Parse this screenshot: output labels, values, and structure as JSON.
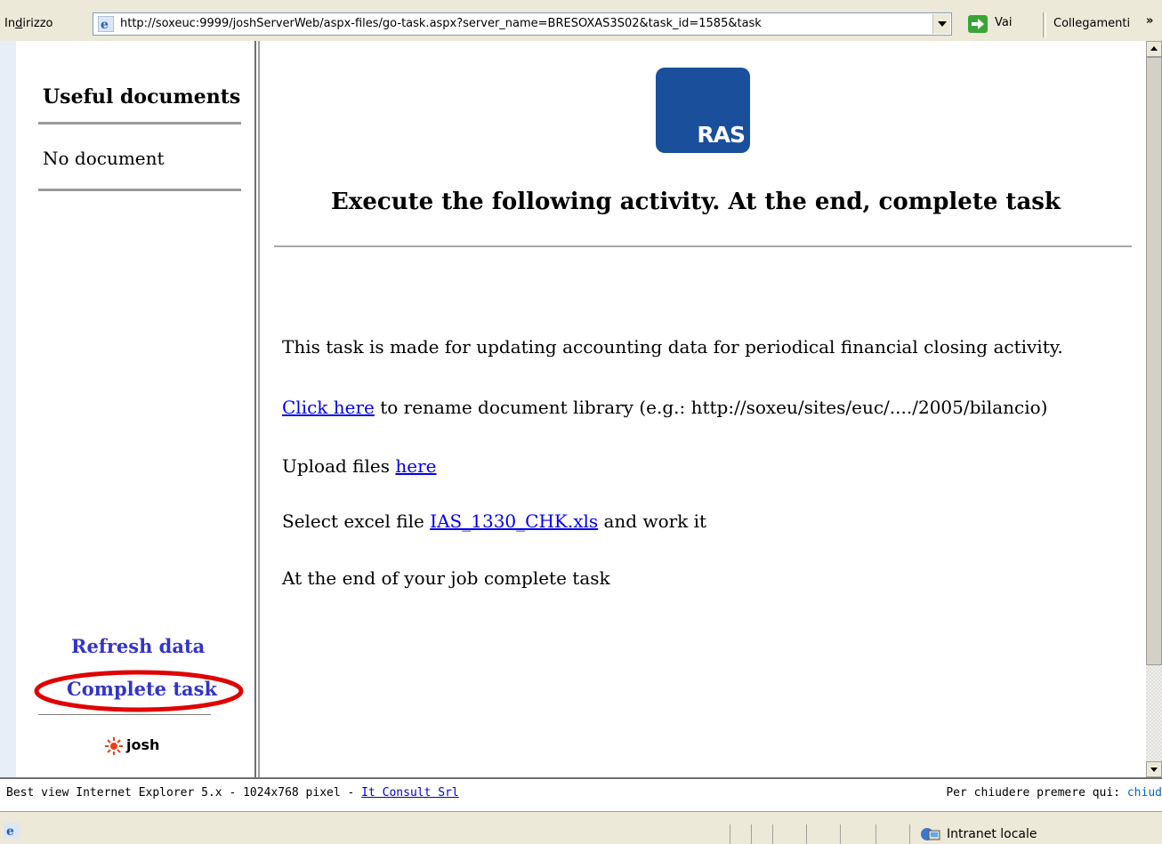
{
  "address_bar": {
    "label_prefix": "In",
    "label_accel": "d",
    "label_suffix": "irizzo",
    "url": "http://soxeuc:9999/joshServerWeb/aspx-files/go-task.aspx?server_name=BRESOXAS3S02&task_id=1585&task",
    "go_label": "Vai",
    "links_label": "Collegamenti",
    "links_chevron": "»"
  },
  "sidebar": {
    "title": "Useful documents",
    "empty_text": "No document",
    "refresh_label": "Refresh data",
    "complete_label": "Complete task",
    "brand": "josh"
  },
  "main": {
    "logo_text": "RAS",
    "title": "Execute the following activity. At the end, complete task",
    "intro": "This task is made for updating accounting data for periodical financial closing activity.",
    "rename_link": "Click here",
    "rename_text": " to rename document library  (e.g.: http://soxeu/sites/euc/..../2005/bilancio)",
    "upload_text": "Upload  files ",
    "upload_link": "here",
    "select_text": "Select excel file ",
    "select_link": "IAS_1330_CHK.xls",
    "select_suffix": " and work it",
    "end_text": "At the end of your job complete task"
  },
  "footer": {
    "best_view": "Best view Internet Explorer 5.x - 1024x768 pixel - ",
    "company_link": "It Consult Srl",
    "close_text": "Per chiudere premere qui: ",
    "close_link": "chiud"
  },
  "status_bar": {
    "zone_label": "Intranet locale"
  },
  "colors": {
    "link_blue": "#0000ee",
    "sidebar_link": "#3333cc",
    "ras_blue": "#1a4f9c",
    "highlight_red": "#e00000"
  },
  "icons": [
    "ie-icon",
    "dropdown-arrow-icon",
    "go-arrow-icon",
    "sun-icon",
    "intranet-zone-icon",
    "scroll-up-icon",
    "scroll-down-icon"
  ]
}
